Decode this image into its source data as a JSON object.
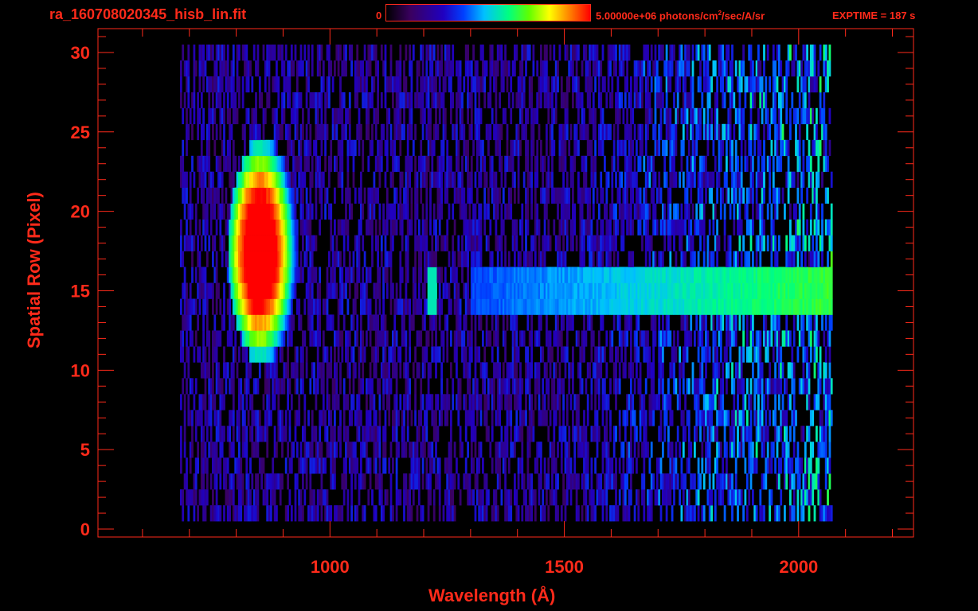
{
  "header": {
    "file_title": "ra_160708020345_hisb_lin.fit",
    "colorbar_min": "0",
    "colorbar_max_prefix": "5.00000e+06 photons/cm",
    "colorbar_max_exp": "2",
    "colorbar_max_suffix": "/sec/A/sr",
    "exptime": "EXPTIME = 187 s"
  },
  "colors": {
    "text": "#ff2a1a",
    "background": "#000000"
  },
  "chart_data": {
    "type": "heatmap",
    "xlabel": "Wavelength (Å)",
    "ylabel": "Spatial Row (Pixel)",
    "xlim": [
      505,
      2245
    ],
    "ylim": [
      -0.5,
      31.5
    ],
    "x_ticks": [
      1000,
      1500,
      2000
    ],
    "y_ticks": [
      0,
      5,
      10,
      15,
      20,
      25,
      30
    ],
    "colormap": "rainbow",
    "colorbar_range": [
      0,
      5000000
    ],
    "colorbar_units": "photons/cm^2/sec/A/sr",
    "data_extent_wavelength": [
      680,
      2070
    ],
    "data_extent_rows": [
      1,
      30
    ],
    "features": [
      {
        "name": "emission blob",
        "wavelength_range": [
          780,
          930
        ],
        "rows": [
          10,
          23
        ],
        "peak_rows": [
          14,
          20
        ]
      },
      {
        "name": "narrow line",
        "wavelength": 1215,
        "rows": [
          14,
          16
        ]
      },
      {
        "name": "continuum band",
        "wavelength_range": [
          1300,
          2070
        ],
        "rows": [
          14,
          16
        ],
        "brightest_wavelength_range": [
          1750,
          2070
        ]
      }
    ]
  }
}
